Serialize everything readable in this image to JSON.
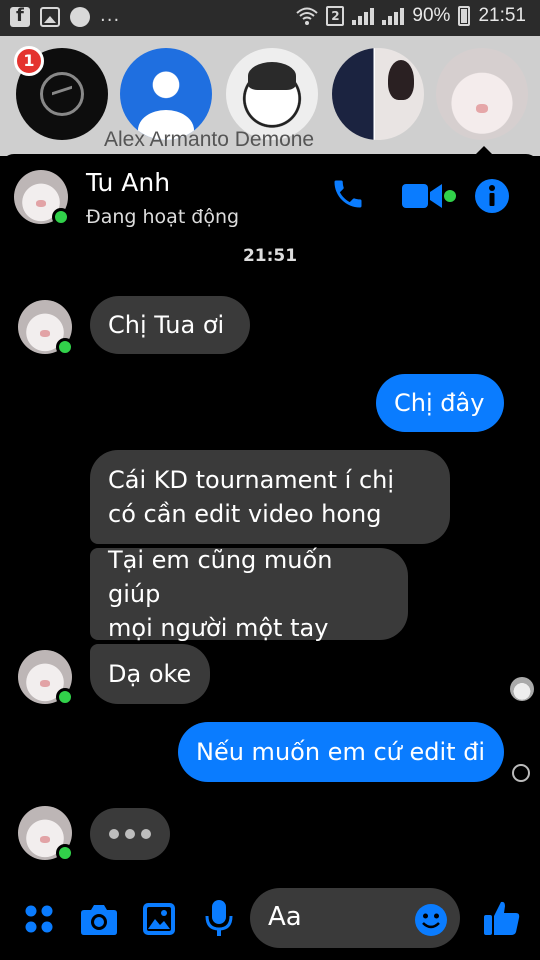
{
  "status_bar": {
    "left_icons": [
      "facebook-icon",
      "gallery-icon",
      "messenger-icon"
    ],
    "overflow": "...",
    "sim_slot": "2",
    "battery_percent": "90%",
    "time": "21:51"
  },
  "stories": {
    "badge_count": "1",
    "partial_name": "Alex Armanto Demone"
  },
  "header": {
    "contact_name": "Tu Anh",
    "status": "Đang hoạt động"
  },
  "conversation": {
    "timestamp": "21:51",
    "messages": [
      {
        "from": "them",
        "text": "Chị Tua ơi"
      },
      {
        "from": "me",
        "text": "Chị đây"
      },
      {
        "from": "them",
        "line1": "Cái KD tournament í chị",
        "line2": "có cần edit video hong"
      },
      {
        "from": "them",
        "line1": "Tại em cũng muốn giúp",
        "line2": "mọi người một tay"
      },
      {
        "from": "them",
        "text": "Dạ oke"
      },
      {
        "from": "me",
        "text": "Nếu muốn em cứ edit đi"
      }
    ]
  },
  "composer": {
    "placeholder": "Aa"
  },
  "colors": {
    "accent": "#0a7cff",
    "incoming_bubble": "#3a3a3a",
    "online": "#31d14a",
    "background": "#000000"
  }
}
